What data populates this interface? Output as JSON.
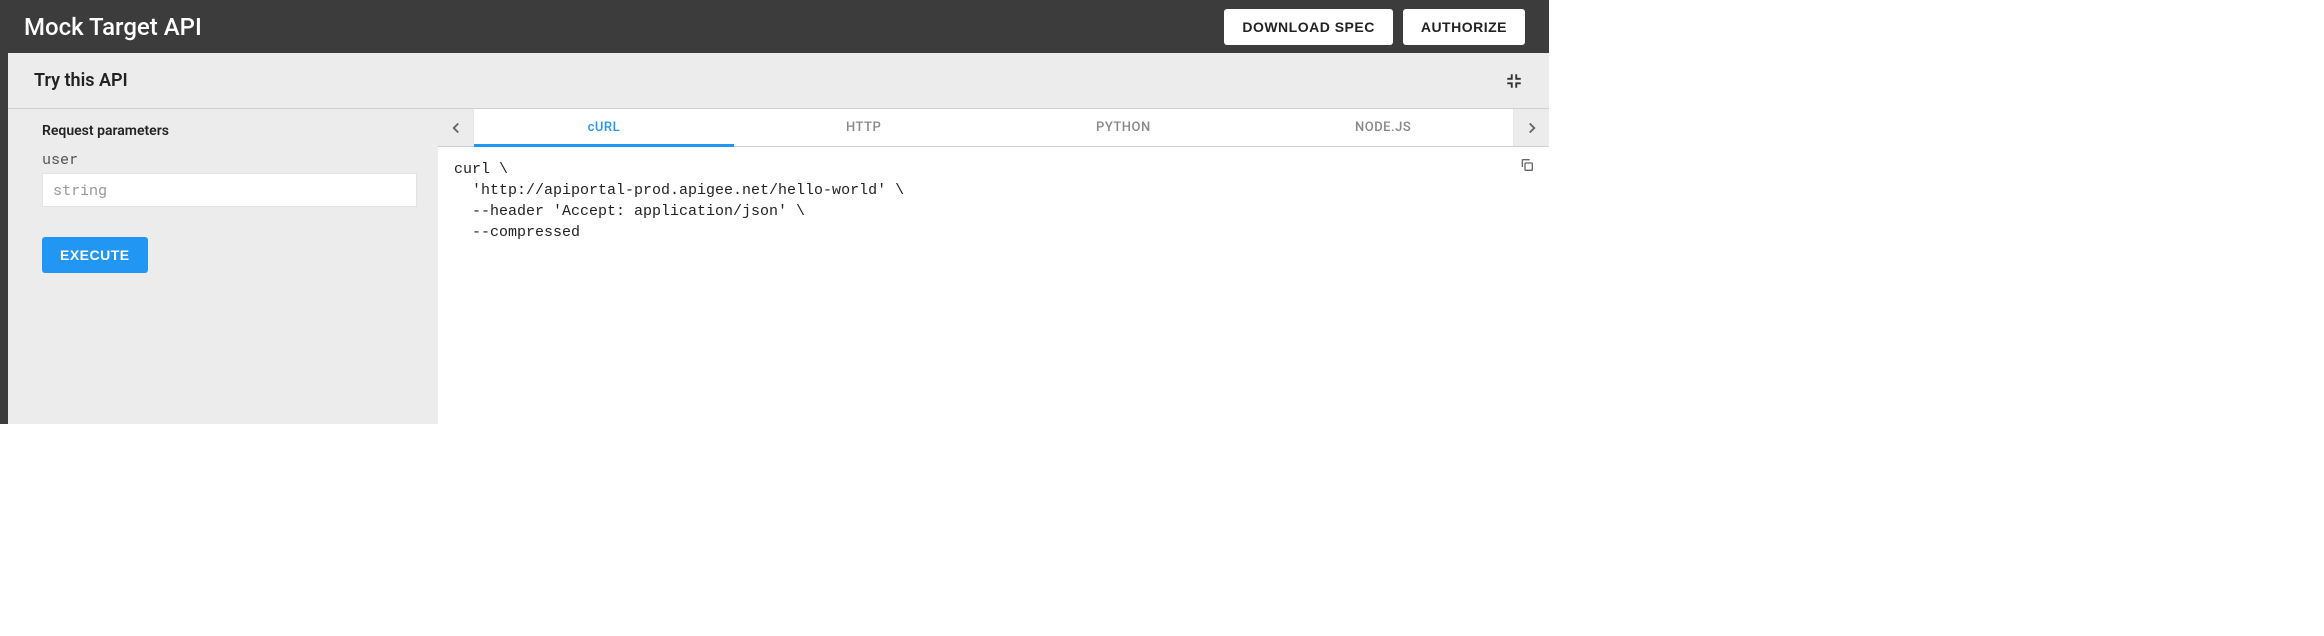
{
  "header": {
    "title": "Mock Target API",
    "download_label": "DOWNLOAD SPEC",
    "authorize_label": "AUTHORIZE"
  },
  "panel": {
    "title": "Try this API"
  },
  "request": {
    "section_label": "Request parameters",
    "params": [
      {
        "name": "user",
        "placeholder": "string",
        "value": ""
      }
    ],
    "execute_label": "EXECUTE"
  },
  "code_tabs": {
    "tabs": [
      {
        "label": "cURL",
        "active": true
      },
      {
        "label": "HTTP",
        "active": false
      },
      {
        "label": "PYTHON",
        "active": false
      },
      {
        "label": "NODE.JS",
        "active": false
      }
    ],
    "code": "curl \\\n  'http://apiportal-prod.apigee.net/hello-world' \\\n  --header 'Accept: application/json' \\\n  --compressed"
  }
}
